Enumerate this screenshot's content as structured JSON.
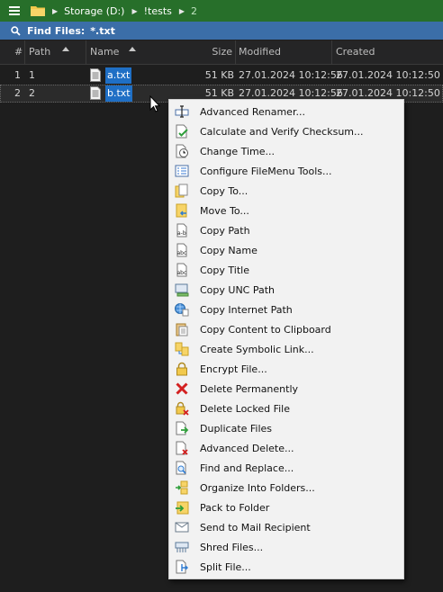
{
  "breadcrumb": {
    "items": [
      "Storage (D:)",
      "!tests",
      "2"
    ]
  },
  "find": {
    "label": "Find Files:",
    "pattern": "*.txt"
  },
  "columns": {
    "path": "Path",
    "name": "Name",
    "size": "Size",
    "modified": "Modified",
    "created": "Created"
  },
  "rows": [
    {
      "num": "1",
      "path": "1",
      "name": "a.txt",
      "size": "51 KB",
      "modified": "27.01.2024 10:12:56",
      "created": "27.01.2024 10:12:50"
    },
    {
      "num": "2",
      "path": "2",
      "name": "b.txt",
      "size": "51 KB",
      "modified": "27.01.2024 10:12:56",
      "created": "27.01.2024 10:12:50"
    }
  ],
  "menu": [
    {
      "label": "Advanced Renamer...",
      "icon": "rename-icon"
    },
    {
      "label": "Calculate and Verify Checksum...",
      "icon": "checksum-icon"
    },
    {
      "label": "Change Time...",
      "icon": "clock-icon"
    },
    {
      "label": "Configure FileMenu Tools...",
      "icon": "configure-icon"
    },
    {
      "label": "Copy To...",
      "icon": "copy-to-icon"
    },
    {
      "label": "Move To...",
      "icon": "move-to-icon"
    },
    {
      "label": "Copy Path",
      "icon": "copy-path-icon"
    },
    {
      "label": "Copy Name",
      "icon": "copy-name-icon"
    },
    {
      "label": "Copy Title",
      "icon": "copy-title-icon"
    },
    {
      "label": "Copy UNC Path",
      "icon": "unc-path-icon"
    },
    {
      "label": "Copy Internet Path",
      "icon": "internet-path-icon"
    },
    {
      "label": "Copy Content to Clipboard",
      "icon": "clipboard-icon"
    },
    {
      "label": "Create Symbolic Link...",
      "icon": "symlink-icon"
    },
    {
      "label": "Encrypt File...",
      "icon": "lock-icon"
    },
    {
      "label": "Delete Permanently",
      "icon": "delete-x-icon"
    },
    {
      "label": "Delete Locked File",
      "icon": "delete-locked-icon"
    },
    {
      "label": "Duplicate Files",
      "icon": "duplicate-icon"
    },
    {
      "label": "Advanced Delete...",
      "icon": "advanced-delete-icon"
    },
    {
      "label": "Find and Replace...",
      "icon": "find-replace-icon"
    },
    {
      "label": "Organize Into Folders...",
      "icon": "organize-icon"
    },
    {
      "label": "Pack to Folder",
      "icon": "pack-folder-icon"
    },
    {
      "label": "Send to Mail Recipient",
      "icon": "mail-icon"
    },
    {
      "label": "Shred Files...",
      "icon": "shred-icon"
    },
    {
      "label": "Split File...",
      "icon": "split-icon"
    }
  ]
}
